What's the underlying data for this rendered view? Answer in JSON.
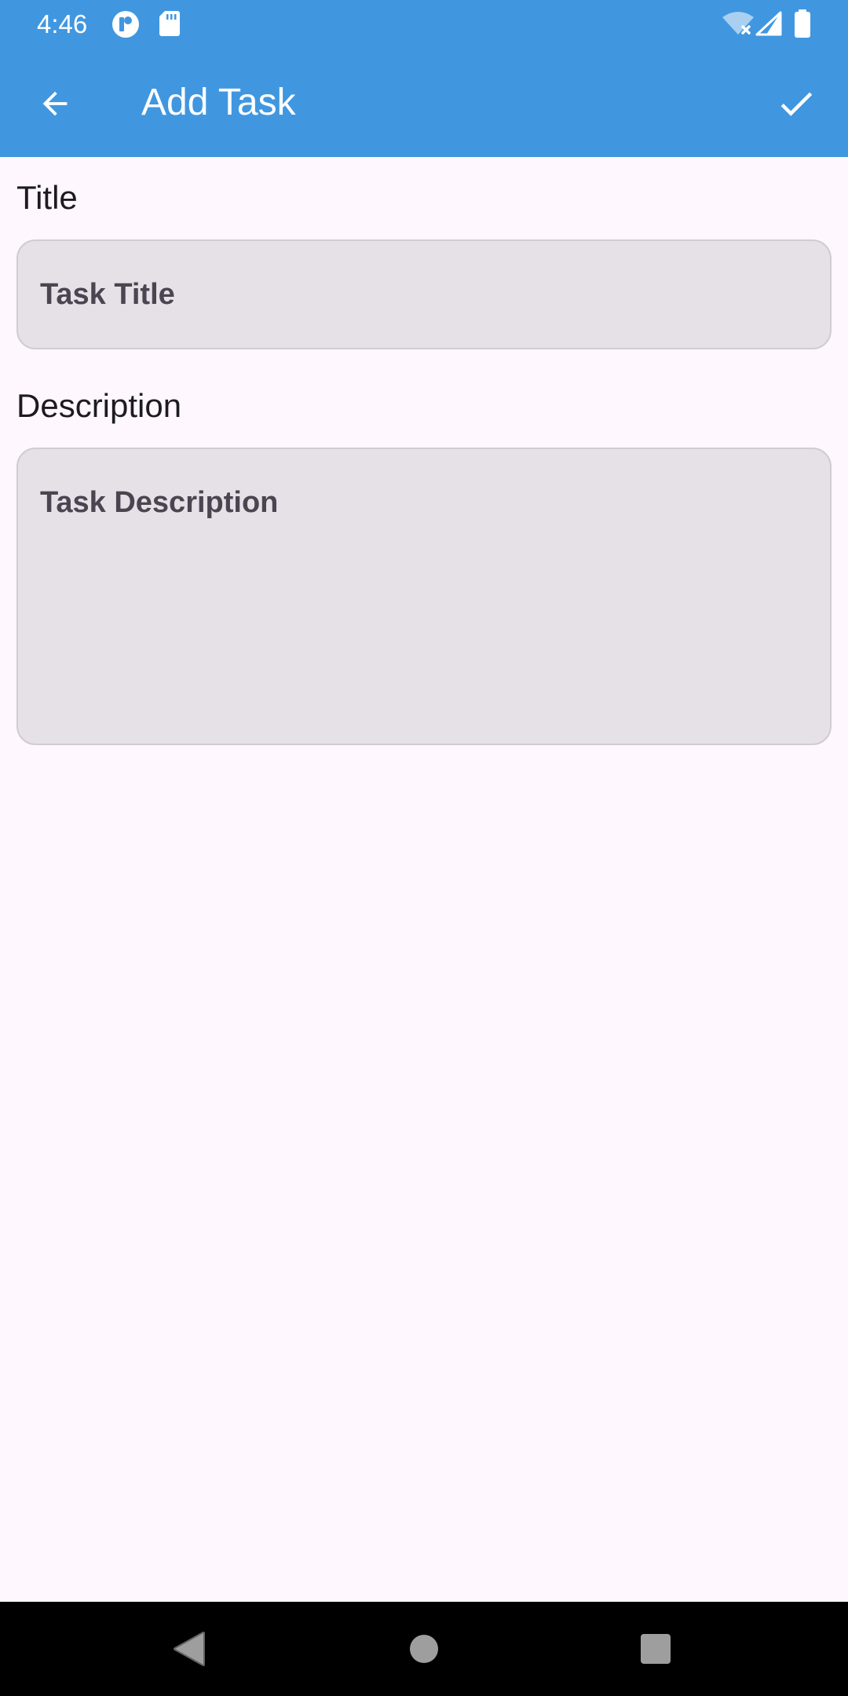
{
  "status_bar": {
    "time": "4:46",
    "left_icons": [
      "tethering-icon",
      "sd-card-icon"
    ],
    "right_icons": [
      "wifi-off-icon",
      "cell-signal-icon",
      "battery-icon"
    ]
  },
  "app_bar": {
    "title": "Add Task",
    "back_icon": "arrow-back-icon",
    "confirm_icon": "check-icon"
  },
  "form": {
    "title_label": "Title",
    "title_placeholder": "Task Title",
    "title_value": "",
    "description_label": "Description",
    "description_placeholder": "Task Description",
    "description_value": ""
  },
  "nav_bar": {
    "buttons": [
      "back-triangle-icon",
      "home-circle-icon",
      "recents-square-icon"
    ]
  },
  "colors": {
    "primary": "#4097e0",
    "background": "#fff7fe",
    "field_fill": "#e6e1e6",
    "nav_bar": "#000000"
  }
}
